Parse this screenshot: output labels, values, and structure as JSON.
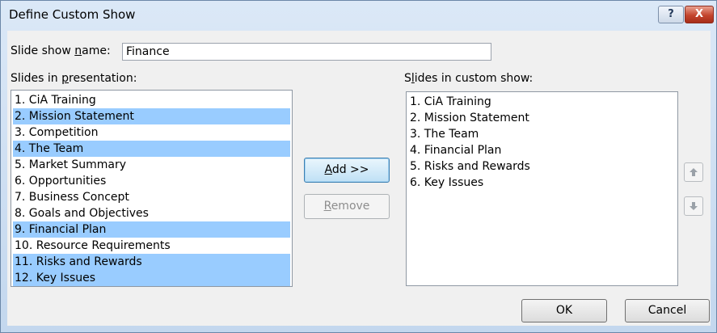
{
  "window": {
    "title": "Define Custom Show",
    "help_glyph": "?",
    "close_glyph": "X"
  },
  "name_field": {
    "label_before": "Slide show ",
    "label_key": "n",
    "label_after": "ame:",
    "value": "Finance"
  },
  "presentation_list": {
    "label_before": "Slides in ",
    "label_key": "p",
    "label_after": "resentation:",
    "items": [
      {
        "text": "1. CiA Training",
        "selected": false
      },
      {
        "text": "2. Mission Statement",
        "selected": true
      },
      {
        "text": "3. Competition",
        "selected": false
      },
      {
        "text": "4. The Team",
        "selected": true
      },
      {
        "text": "5. Market Summary",
        "selected": false
      },
      {
        "text": "6. Opportunities",
        "selected": false
      },
      {
        "text": "7. Business Concept",
        "selected": false
      },
      {
        "text": "8. Goals and Objectives",
        "selected": false
      },
      {
        "text": "9. Financial Plan",
        "selected": true
      },
      {
        "text": "10. Resource Requirements",
        "selected": false
      },
      {
        "text": "11. Risks and Rewards",
        "selected": true
      },
      {
        "text": "12. Key Issues",
        "selected": true
      }
    ]
  },
  "custom_list": {
    "label_before": "S",
    "label_key": "l",
    "label_after": "ides in custom show:",
    "items": [
      "1. CiA Training",
      "2. Mission Statement",
      "3. The Team",
      "4. Financial Plan",
      "5. Risks and Rewards",
      "6. Key Issues"
    ]
  },
  "buttons": {
    "add_key": "A",
    "add_rest": "dd >>",
    "remove_key": "R",
    "remove_rest": "emove",
    "ok": "OK",
    "cancel": "Cancel"
  },
  "icons": {
    "move_up": "arrow-up-icon",
    "move_down": "arrow-down-icon"
  },
  "colors": {
    "selection": "#99ccff",
    "close_button": "#c4452e"
  }
}
